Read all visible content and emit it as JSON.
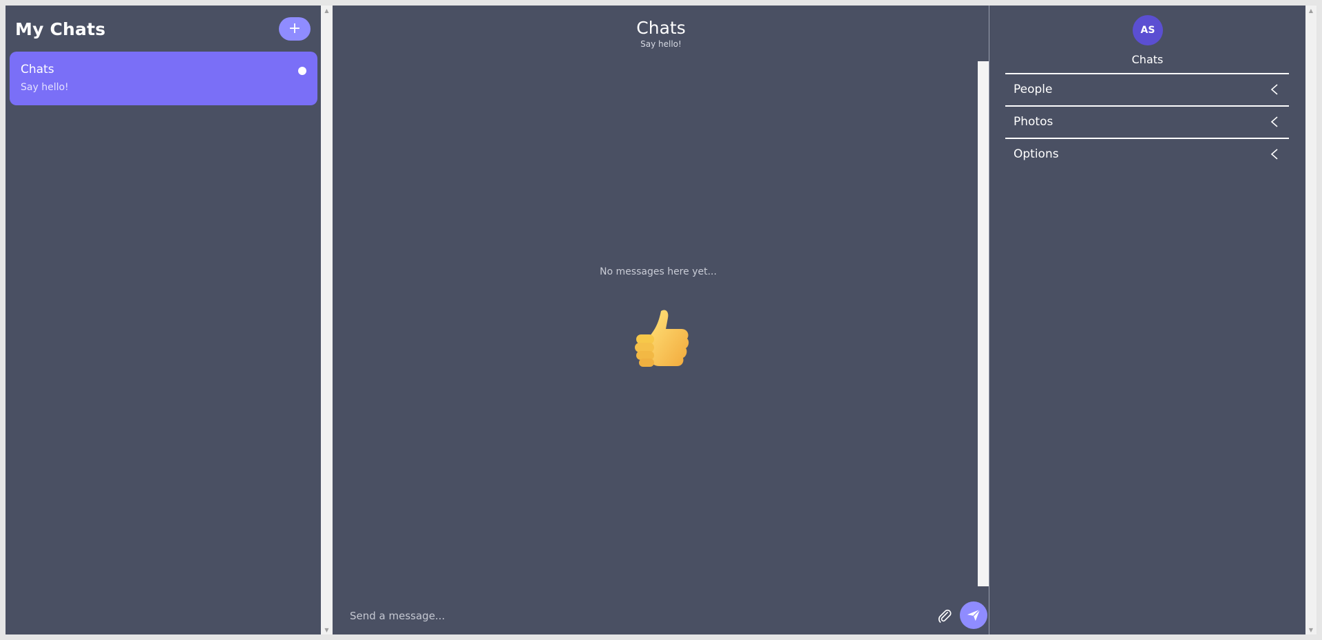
{
  "sidebar": {
    "title": "My Chats",
    "new_chat_label": "+",
    "chats": [
      {
        "title": "Chats",
        "preview": "Say hello!",
        "unread": true
      }
    ]
  },
  "main": {
    "title": "Chats",
    "subtitle": "Say hello!",
    "empty_state": "No messages here yet...",
    "empty_icon": "thumbs-up-icon",
    "input_placeholder": "Send a message..."
  },
  "details": {
    "avatar_initials": "AS",
    "title": "Chats",
    "sections": [
      {
        "label": "People"
      },
      {
        "label": "Photos"
      },
      {
        "label": "Options"
      }
    ]
  },
  "colors": {
    "background": "#4a5063",
    "accent": "#8f8cff",
    "active_chat": "#7a6ff7",
    "avatar": "#5b4fd2"
  }
}
